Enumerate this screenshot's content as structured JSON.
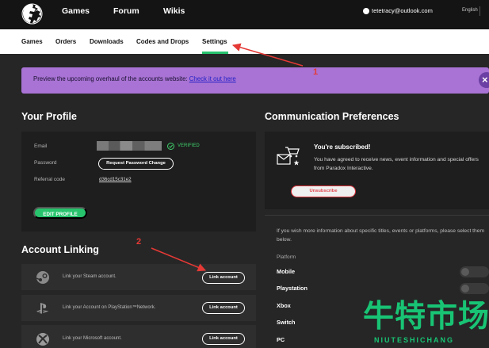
{
  "header": {
    "nav": [
      "Games",
      "Forum",
      "Wikis"
    ],
    "account_email": "tetetracy@outlook.com",
    "language": "English"
  },
  "tabs": [
    "Games",
    "Orders",
    "Downloads",
    "Codes and Drops",
    "Settings"
  ],
  "active_tab": "Settings",
  "banner": {
    "text": "Preview the upcoming overhaul of the accounts website: ",
    "link": "Check it out here",
    "close": "×"
  },
  "profile": {
    "title": "Your Profile",
    "email_label": "Email",
    "verified": "VERIFIED",
    "password_label": "Password",
    "password_button": "Request Password Change",
    "referral_label": "Referral code",
    "referral_code": "d36cd15c31e2",
    "edit_button": "EDIT PROFILE"
  },
  "account_linking": {
    "title": "Account Linking",
    "rows": [
      {
        "icon": "steam-icon",
        "text": "Link your Steam account.",
        "button": "Link account"
      },
      {
        "icon": "playstation-icon",
        "text": "Link your Account on PlayStation™Network.",
        "button": "Link account"
      },
      {
        "icon": "xbox-icon",
        "text": "Link your Microsoft account.",
        "button": "Link account"
      }
    ]
  },
  "communication": {
    "title": "Communication Preferences",
    "subscribed_title": "You're subscribed!",
    "subscribed_body": "You have agreed to receive news, event information and special offers from Paradox Interactive.",
    "unsubscribe": "Unsubscribe",
    "info": "If you wish more information about specific titles, events or platforms, please select them below.",
    "platforms_label": "Platform",
    "platforms": [
      "Mobile",
      "Playstation",
      "Xbox",
      "Switch",
      "PC"
    ]
  },
  "annotations": {
    "marker_1": "1",
    "marker_2": "2",
    "color": "#e53935"
  },
  "watermark": {
    "cn": "牛特市场",
    "en": "NIUTESHICHANG",
    "color": "#18c474"
  },
  "colors": {
    "accent_green": "#27c46d",
    "banner_purple": "#a873d4",
    "unsubscribe_red": "#d8323b"
  }
}
